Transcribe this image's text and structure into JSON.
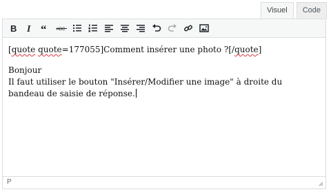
{
  "tabs": [
    {
      "label": "Visuel",
      "active": true
    },
    {
      "label": "Code",
      "active": false
    }
  ],
  "toolbar": {
    "buttons": [
      {
        "name": "bold-button",
        "icon": "bold-icon"
      },
      {
        "name": "italic-button",
        "icon": "italic-icon"
      },
      {
        "name": "blockquote-button",
        "icon": "blockquote-icon"
      },
      {
        "name": "strikethrough-button",
        "icon": "strikethrough-icon"
      },
      {
        "name": "bullet-list-button",
        "icon": "bullet-list-icon"
      },
      {
        "name": "numbered-list-button",
        "icon": "numbered-list-icon"
      },
      {
        "name": "align-left-button",
        "icon": "align-left-icon"
      },
      {
        "name": "align-center-button",
        "icon": "align-center-icon"
      },
      {
        "name": "align-right-button",
        "icon": "align-right-icon"
      },
      {
        "name": "undo-button",
        "icon": "undo-icon"
      },
      {
        "name": "redo-button",
        "icon": "redo-icon"
      },
      {
        "name": "insert-link-button",
        "icon": "link-icon"
      },
      {
        "name": "insert-image-button",
        "icon": "image-icon"
      }
    ]
  },
  "content": {
    "quote_open": "[",
    "quote_word1": "quote",
    "quote_space": " ",
    "quote_word2": "quote",
    "quote_rest": "=177055]Comment insérer une photo ?[/",
    "quote_close_word": "quote",
    "quote_end": "]",
    "line_greeting": "Bonjour",
    "line_body": "Il faut utiliser le bouton \"Insérer/Modifier une image\" à droite du bandeau de saisie de réponse."
  },
  "statusbar": {
    "path": "P"
  },
  "colors": {
    "border": "#dcdcde",
    "toolbar_bg": "#f6f7f7",
    "spellcheck": "#d63638"
  }
}
